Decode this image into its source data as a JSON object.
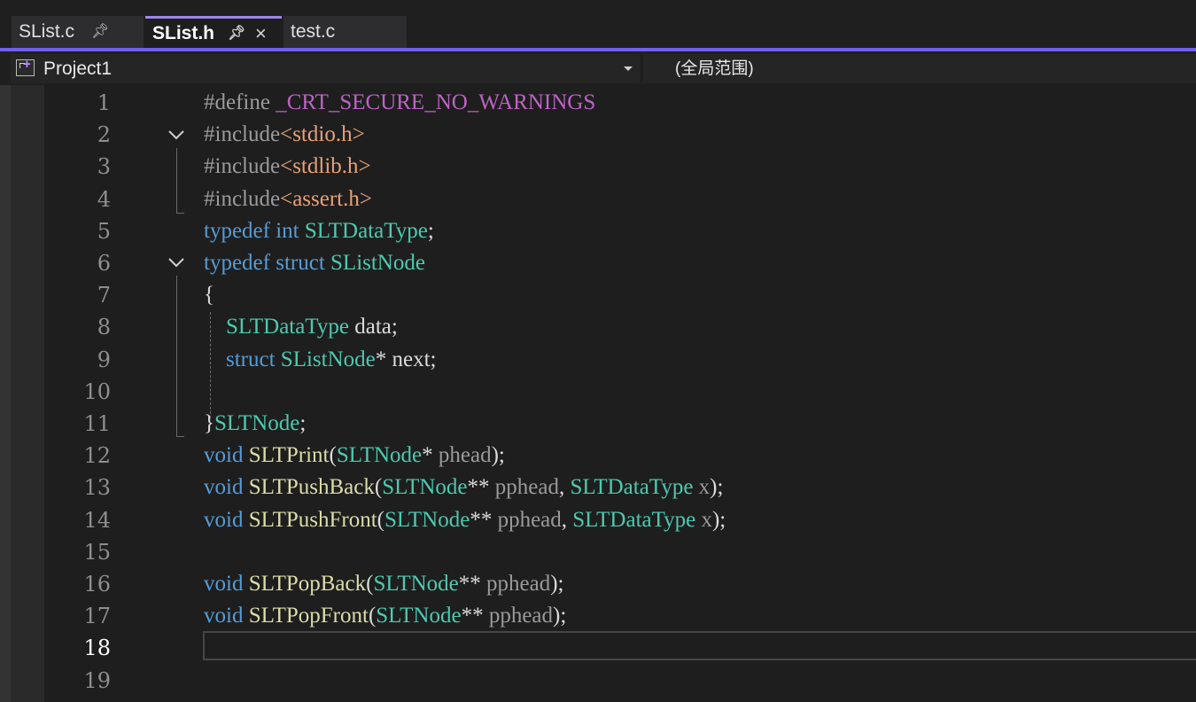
{
  "tabs": [
    {
      "label": "SList.c",
      "pin": "pin-icon",
      "active": false
    },
    {
      "label": "SList.h",
      "pin": "pin-icon",
      "close": "×",
      "active": true
    },
    {
      "label": "test.c",
      "active": false
    }
  ],
  "navbar": {
    "project": "Project1",
    "scope": "(全局范围)"
  },
  "colors": {
    "background": "#1e1e1e",
    "accent": "#7160e8",
    "keyword": "#569cd6",
    "type": "#4ec9b0",
    "function": "#dcdcaa",
    "string": "#e8a176",
    "macro": "#bd63c5"
  },
  "editor": {
    "current_line": 18,
    "line_numbers": [
      "1",
      "2",
      "3",
      "4",
      "5",
      "6",
      "7",
      "8",
      "9",
      "10",
      "11",
      "12",
      "13",
      "14",
      "15",
      "16",
      "17",
      "18",
      "19"
    ],
    "lines": [
      [
        [
          "pp",
          "#define "
        ],
        [
          "mac",
          "_CRT_SECURE_NO_WARNINGS"
        ]
      ],
      [
        [
          "pp",
          "#include"
        ],
        [
          "str",
          "<stdio.h>"
        ]
      ],
      [
        [
          "pp",
          "#include"
        ],
        [
          "str",
          "<stdlib.h>"
        ]
      ],
      [
        [
          "pp",
          "#include"
        ],
        [
          "str",
          "<assert.h>"
        ]
      ],
      [
        [
          "kw",
          "typedef"
        ],
        [
          "op",
          " "
        ],
        [
          "kw",
          "int"
        ],
        [
          "op",
          " "
        ],
        [
          "typ",
          "SLTDataType"
        ],
        [
          "op",
          ";"
        ]
      ],
      [
        [
          "kw",
          "typedef"
        ],
        [
          "op",
          " "
        ],
        [
          "kw",
          "struct"
        ],
        [
          "op",
          " "
        ],
        [
          "typ",
          "SListNode"
        ]
      ],
      [
        [
          "op",
          "{"
        ]
      ],
      [
        [
          "op",
          "    "
        ],
        [
          "typ",
          "SLTDataType"
        ],
        [
          "op",
          " "
        ],
        [
          "id",
          "data"
        ],
        [
          "op",
          ";"
        ]
      ],
      [
        [
          "op",
          "    "
        ],
        [
          "kw",
          "struct"
        ],
        [
          "op",
          " "
        ],
        [
          "typ",
          "SListNode"
        ],
        [
          "op",
          "* "
        ],
        [
          "id",
          "next"
        ],
        [
          "op",
          ";"
        ]
      ],
      [],
      [
        [
          "op",
          "}"
        ],
        [
          "typ",
          "SLTNode"
        ],
        [
          "op",
          ";"
        ]
      ],
      [
        [
          "kw",
          "void"
        ],
        [
          "op",
          " "
        ],
        [
          "fn",
          "SLTPrint"
        ],
        [
          "op",
          "("
        ],
        [
          "typ",
          "SLTNode"
        ],
        [
          "op",
          "* "
        ],
        [
          "prm",
          "phead"
        ],
        [
          "op",
          ");"
        ]
      ],
      [
        [
          "kw",
          "void"
        ],
        [
          "op",
          " "
        ],
        [
          "fn",
          "SLTPushBack"
        ],
        [
          "op",
          "("
        ],
        [
          "typ",
          "SLTNode"
        ],
        [
          "op",
          "** "
        ],
        [
          "prm",
          "pphead"
        ],
        [
          "op",
          ", "
        ],
        [
          "typ",
          "SLTDataType"
        ],
        [
          "op",
          " "
        ],
        [
          "prm",
          "x"
        ],
        [
          "op",
          ");"
        ]
      ],
      [
        [
          "kw",
          "void"
        ],
        [
          "op",
          " "
        ],
        [
          "fn",
          "SLTPushFront"
        ],
        [
          "op",
          "("
        ],
        [
          "typ",
          "SLTNode"
        ],
        [
          "op",
          "** "
        ],
        [
          "prm",
          "pphead"
        ],
        [
          "op",
          ", "
        ],
        [
          "typ",
          "SLTDataType"
        ],
        [
          "op",
          " "
        ],
        [
          "prm",
          "x"
        ],
        [
          "op",
          ");"
        ]
      ],
      [],
      [
        [
          "kw",
          "void"
        ],
        [
          "op",
          " "
        ],
        [
          "fn",
          "SLTPopBack"
        ],
        [
          "op",
          "("
        ],
        [
          "typ",
          "SLTNode"
        ],
        [
          "op",
          "** "
        ],
        [
          "prm",
          "pphead"
        ],
        [
          "op",
          ");"
        ]
      ],
      [
        [
          "kw",
          "void"
        ],
        [
          "op",
          " "
        ],
        [
          "fn",
          "SLTPopFront"
        ],
        [
          "op",
          "("
        ],
        [
          "typ",
          "SLTNode"
        ],
        [
          "op",
          "** "
        ],
        [
          "prm",
          "pphead"
        ],
        [
          "op",
          ");"
        ]
      ],
      [],
      []
    ],
    "fold_markers": [
      "chevron-down-icon",
      "chevron-down-icon"
    ]
  }
}
